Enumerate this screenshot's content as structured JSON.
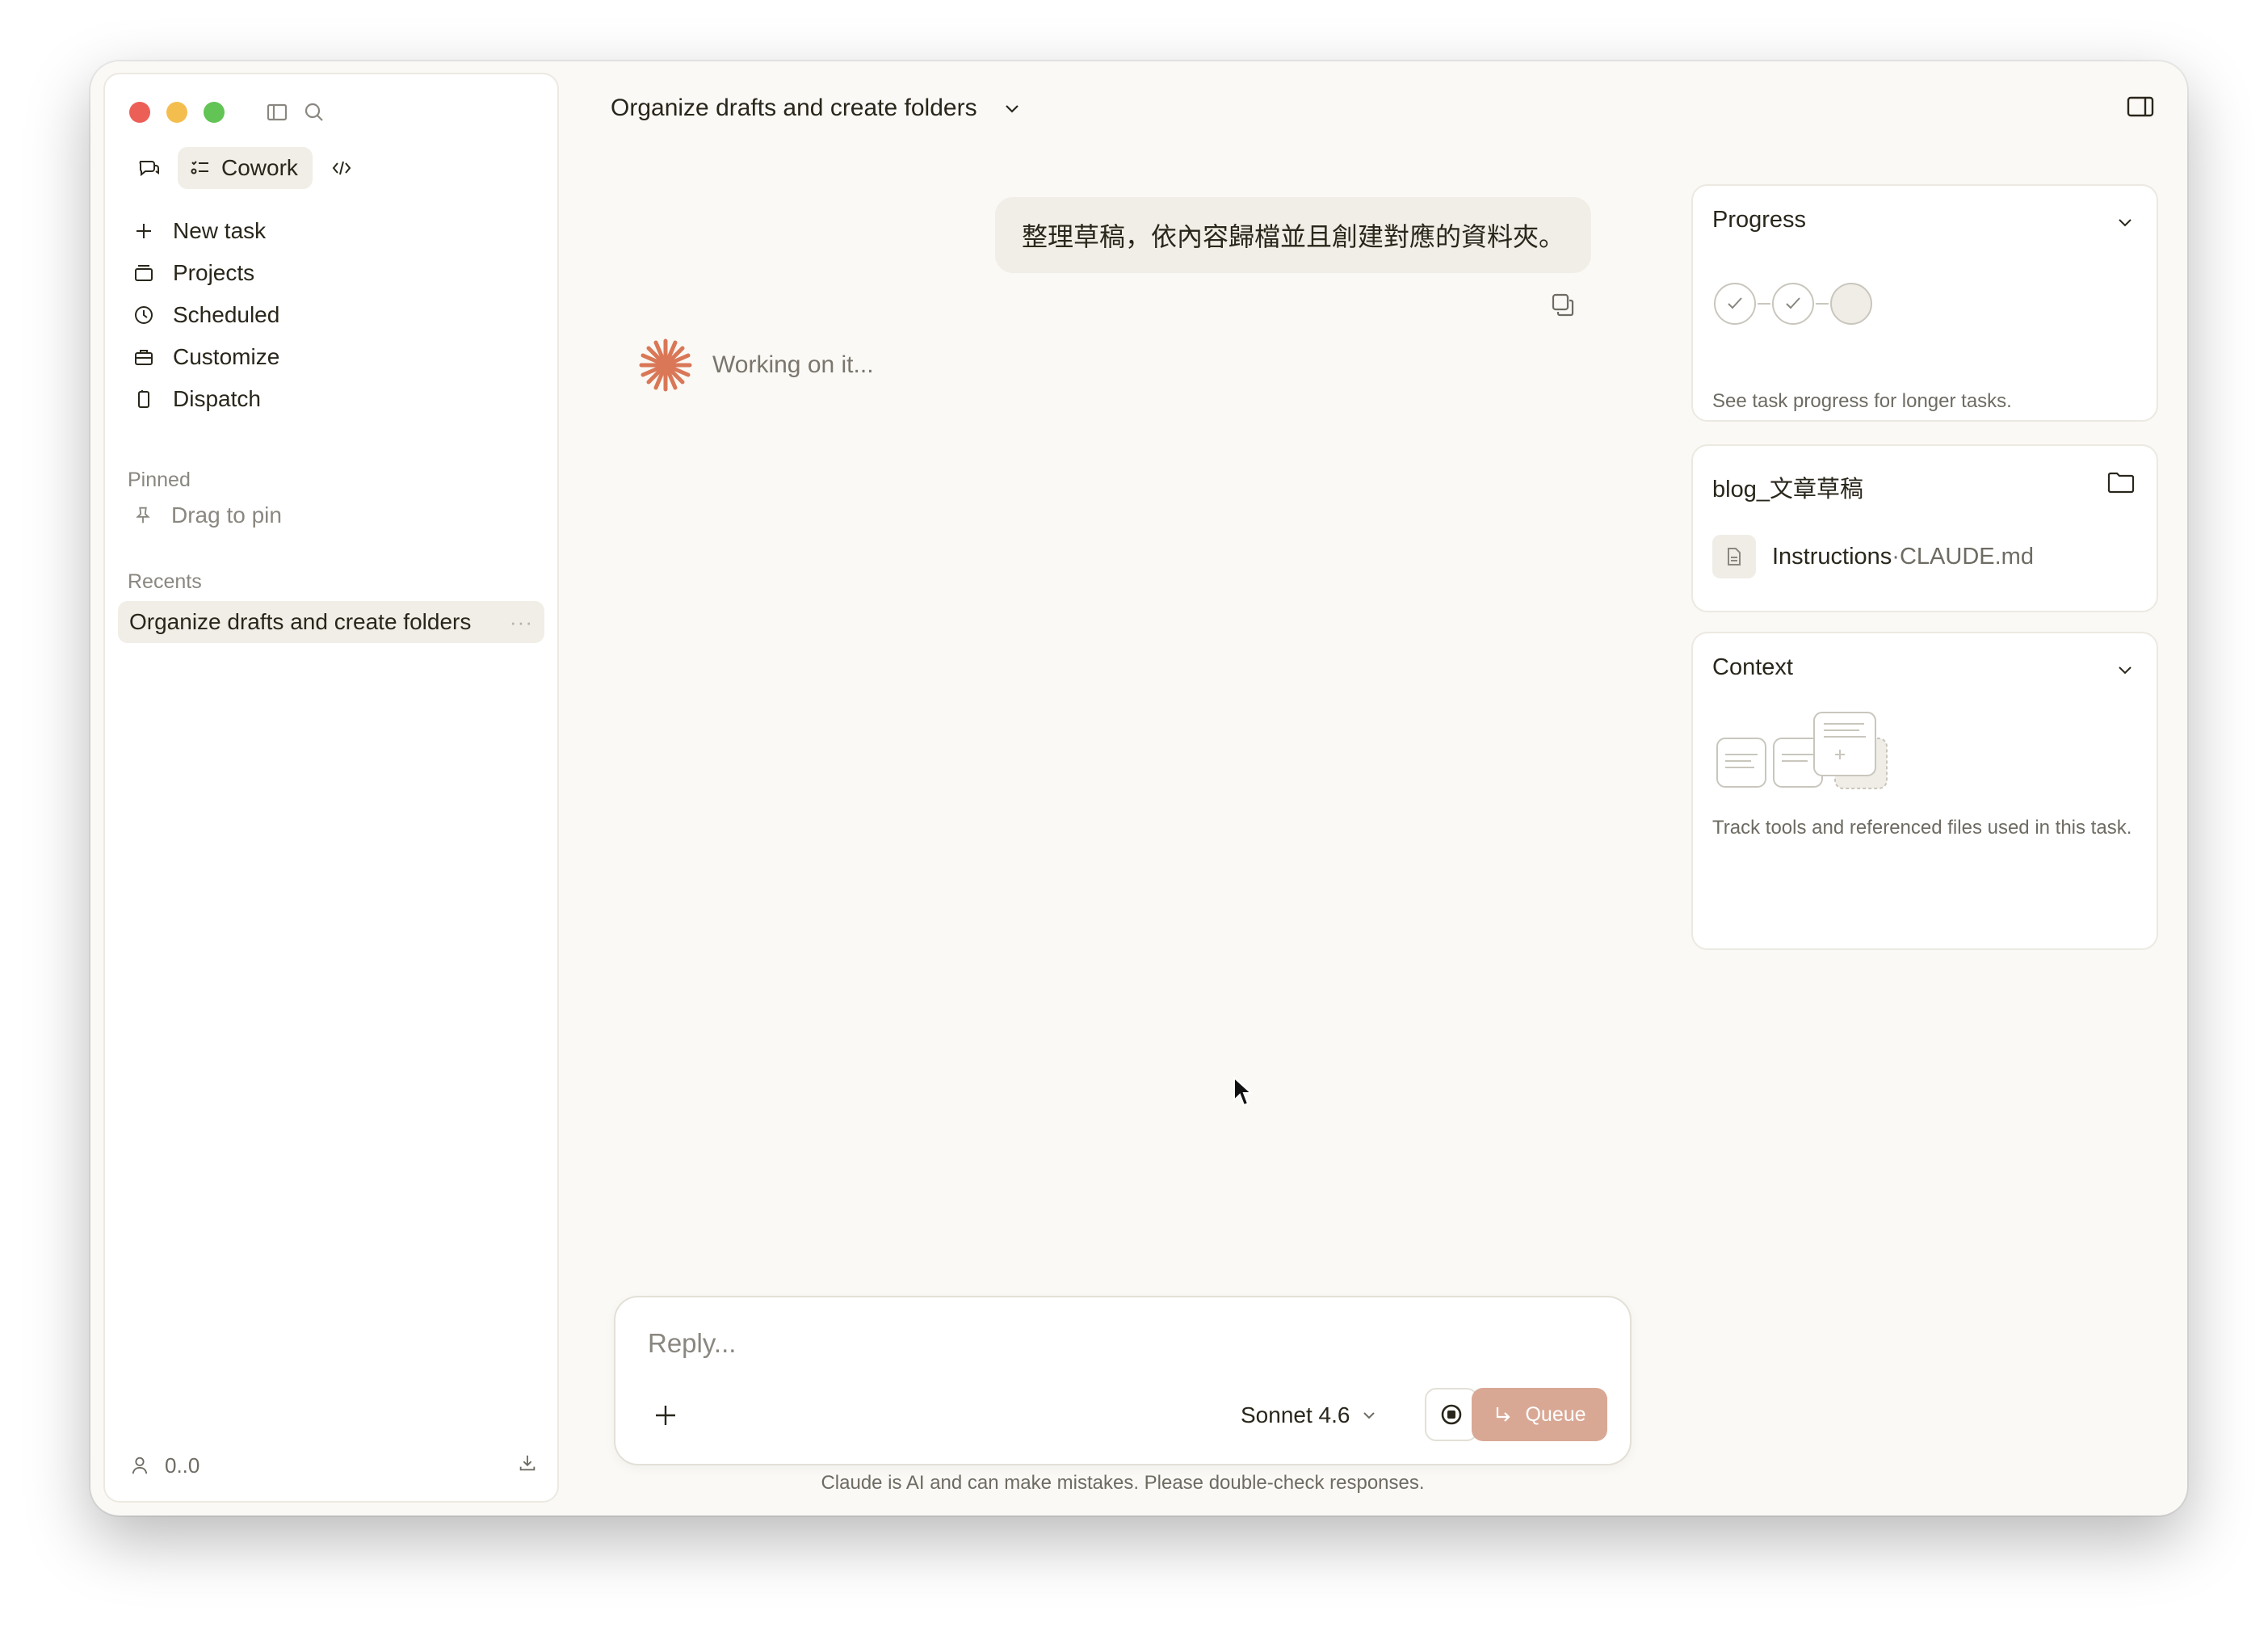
{
  "window": {
    "title": "Organize drafts and create folders"
  },
  "sidebar": {
    "mode_active_label": "Cowork",
    "nav": [
      {
        "label": "New task",
        "icon": "plus-icon"
      },
      {
        "label": "Projects",
        "icon": "projects-icon"
      },
      {
        "label": "Scheduled",
        "icon": "clock-icon"
      },
      {
        "label": "Customize",
        "icon": "briefcase-icon"
      },
      {
        "label": "Dispatch",
        "icon": "phone-icon"
      }
    ],
    "pinned_label": "Pinned",
    "pin_hint": "Drag to pin",
    "recents_label": "Recents",
    "recents": [
      {
        "label": "Organize drafts and create folders"
      }
    ],
    "recent_more": "···",
    "footer_user": "0..0"
  },
  "chat": {
    "user_message": "整理草稿，依內容歸檔並且創建對應的資料夾。",
    "status": "Working on it...",
    "accent_color": "#d97757"
  },
  "composer": {
    "placeholder": "Reply...",
    "model": "Sonnet 4.6",
    "queue_label": "Queue",
    "disclaimer": "Claude is AI and can make mistakes. Please double-check responses."
  },
  "panels": {
    "progress": {
      "title": "Progress",
      "description": "See task progress for longer tasks."
    },
    "folder": {
      "title": "blog_文章草稿",
      "file_label": "Instructions",
      "file_sep": " · ",
      "file_name": "CLAUDE.md"
    },
    "context": {
      "title": "Context",
      "description": "Track tools and referenced files used in this task."
    }
  }
}
